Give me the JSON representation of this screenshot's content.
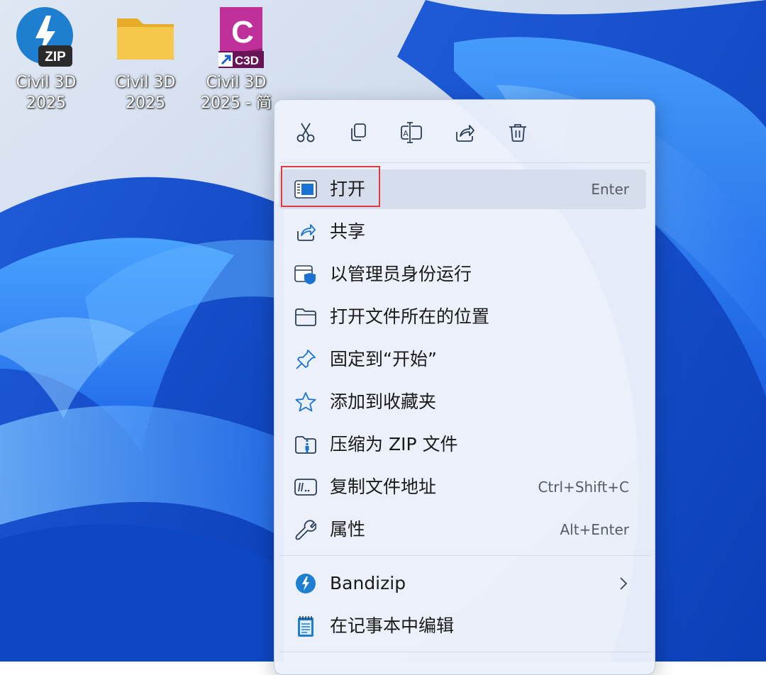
{
  "desktop": {
    "icons": [
      {
        "name": "zip-archive",
        "line1": "Civil 3D",
        "line2": "2025",
        "badge": "ZIP",
        "icon": "bandizip-zip-icon"
      },
      {
        "name": "folder",
        "line1": "Civil 3D",
        "line2": "2025",
        "icon": "folder-icon"
      },
      {
        "name": "shortcut",
        "line1": "Civil 3D",
        "line2": "2025 - 简",
        "badge": "C3D",
        "letter": "C",
        "icon": "civil3d-shortcut-icon"
      }
    ]
  },
  "menu": {
    "toolbar": [
      "cut-icon",
      "copy-icon",
      "rename-icon",
      "share-icon",
      "delete-icon"
    ],
    "items": [
      {
        "label": "打开",
        "shortcut": "Enter",
        "icon": "open-app-icon"
      },
      {
        "label": "共享",
        "shortcut": "",
        "icon": "share-icon"
      },
      {
        "label": "以管理员身份运行",
        "shortcut": "",
        "icon": "run-as-admin-icon"
      },
      {
        "label": "打开文件所在的位置",
        "shortcut": "",
        "icon": "folder-open-icon"
      },
      {
        "label": "固定到“开始”",
        "shortcut": "",
        "icon": "pin-icon"
      },
      {
        "label": "添加到收藏夹",
        "shortcut": "",
        "icon": "star-icon"
      },
      {
        "label": "压缩为 ZIP 文件",
        "shortcut": "",
        "icon": "zip-folder-icon"
      },
      {
        "label": "复制文件地址",
        "shortcut": "Ctrl+Shift+C",
        "icon": "copy-path-icon"
      },
      {
        "label": "属性",
        "shortcut": "Alt+Enter",
        "icon": "wrench-icon"
      }
    ],
    "extra_items": [
      {
        "label": "Bandizip",
        "icon": "bandizip-icon",
        "submenu": true
      },
      {
        "label": "在记事本中编辑",
        "icon": "notepad-icon"
      }
    ]
  },
  "colors": {
    "accent": "#1a73d4",
    "highlight_border": "#e03a3a",
    "zip_icon_blue": "#1e7fd0",
    "folder_yellow": "#f5c84c",
    "civil3d_purple": "#8e1f74"
  }
}
